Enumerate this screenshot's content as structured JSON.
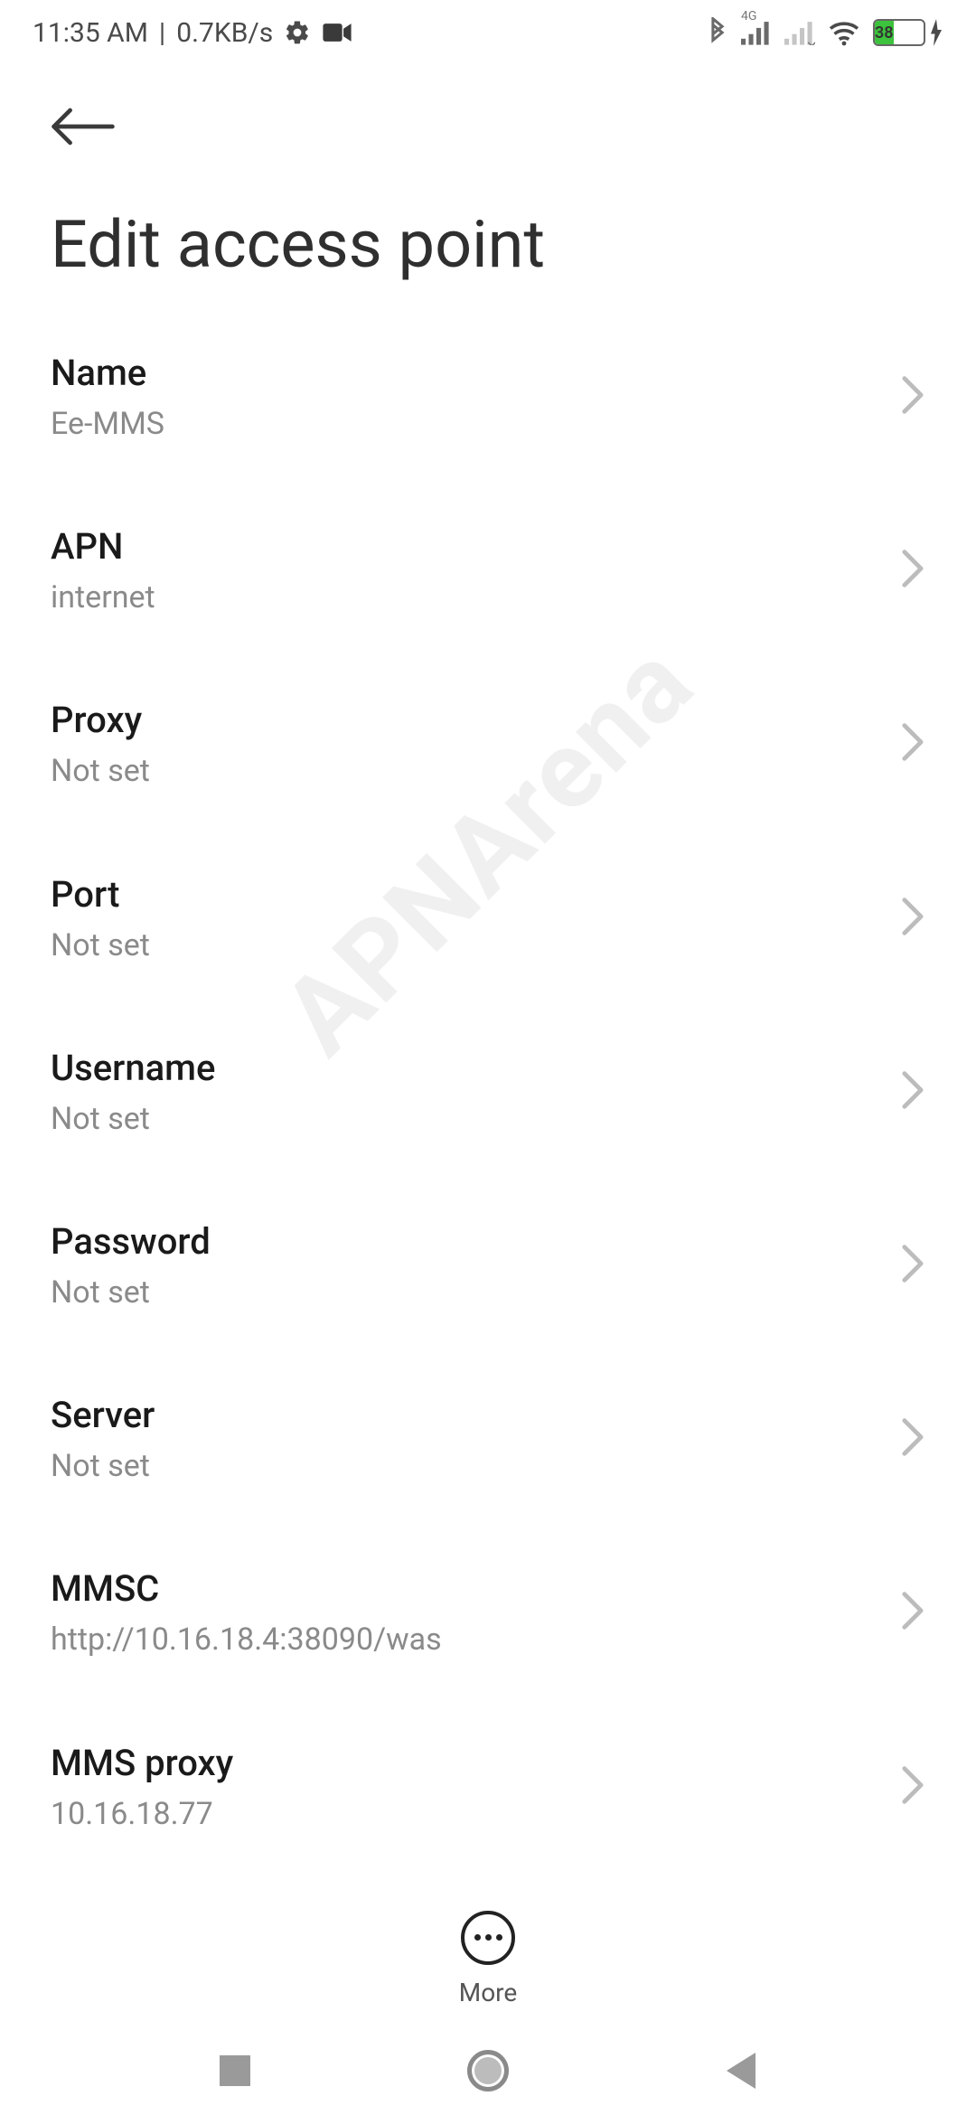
{
  "status_bar": {
    "time": "11:35 AM",
    "speed": "0.7KB/s",
    "network_label": "4G",
    "battery_percent": "38",
    "battery_fill_css_width": "38%"
  },
  "header": {
    "title": "Edit access point"
  },
  "settings": [
    {
      "label": "Name",
      "value": "Ee-MMS"
    },
    {
      "label": "APN",
      "value": "internet"
    },
    {
      "label": "Proxy",
      "value": "Not set"
    },
    {
      "label": "Port",
      "value": "Not set"
    },
    {
      "label": "Username",
      "value": "Not set"
    },
    {
      "label": "Password",
      "value": "Not set"
    },
    {
      "label": "Server",
      "value": "Not set"
    },
    {
      "label": "MMSC",
      "value": "http://10.16.18.4:38090/was"
    },
    {
      "label": "MMS proxy",
      "value": "10.16.18.77"
    }
  ],
  "bottom": {
    "more_label": "More"
  },
  "watermark": "APNArena"
}
